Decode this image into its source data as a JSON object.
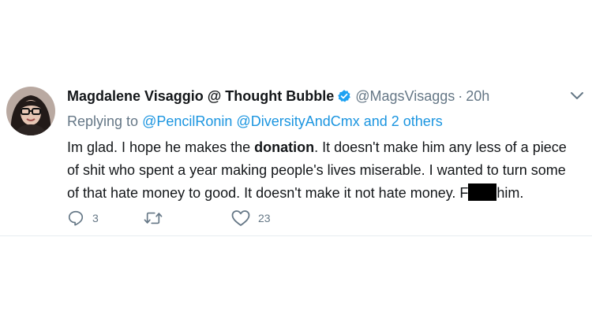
{
  "tweet": {
    "display_name": "Magdalene Visaggio @ Thought Bubble",
    "handle": "@MagsVisaggs",
    "separator": "·",
    "time": "20h",
    "reply": {
      "prefix": "Replying to",
      "mentions": [
        "@PencilRonin",
        "@DiversityAndCmx"
      ],
      "others": "and 2 others"
    },
    "body": {
      "part1": "Im glad. I hope he makes the ",
      "bold": "donation",
      "part2": ". It doesn't make him any less of a piece of shit who spent a year making people's lives miserable. I wanted to turn some of that hate money to good. It doesn't make it not hate money. F",
      "part3": "him."
    },
    "actions": {
      "reply_count": "3",
      "retweet_count": "",
      "like_count": "23"
    }
  },
  "icons": {
    "verified": "verified-badge-icon",
    "caret": "chevron-down-icon",
    "reply": "reply-icon",
    "retweet": "retweet-icon",
    "like": "heart-icon"
  },
  "colors": {
    "link": "#1b95e0",
    "secondary": "#657786",
    "verified": "#1da1f2",
    "redaction": "#000000"
  }
}
